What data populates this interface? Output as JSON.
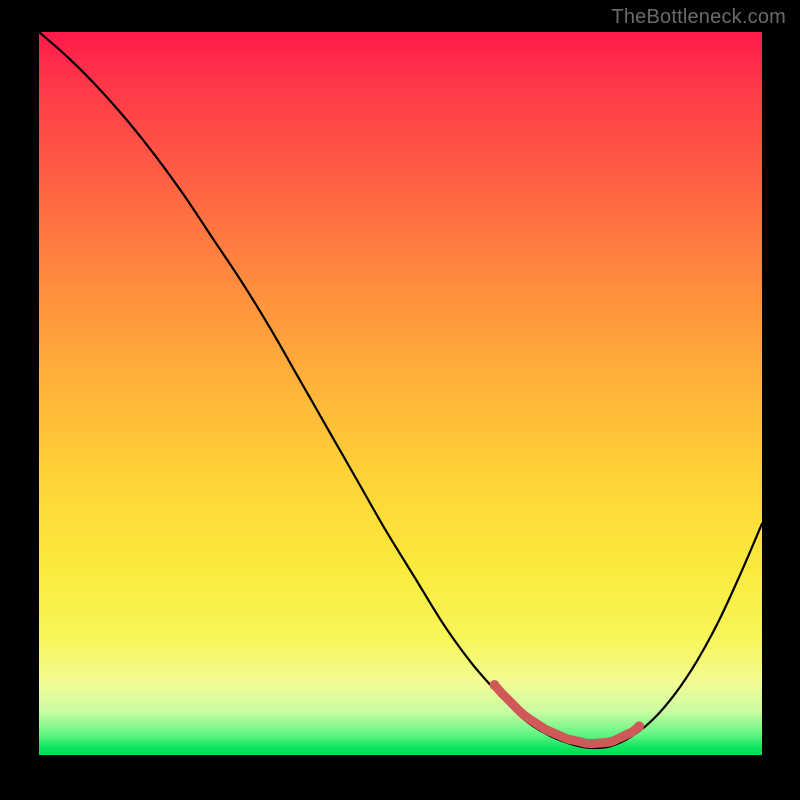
{
  "source": "TheBottleneck.com",
  "chart_data": {
    "type": "line",
    "title": "",
    "xlabel": "",
    "ylabel": "",
    "xlim": [
      0,
      100
    ],
    "ylim": [
      0,
      100
    ],
    "background": "vertical-heat-gradient",
    "gradient_stops": [
      {
        "pos": 0.0,
        "color": "#ff1a4b"
      },
      {
        "pos": 0.08,
        "color": "#ff3a49"
      },
      {
        "pos": 0.22,
        "color": "#ff6543"
      },
      {
        "pos": 0.35,
        "color": "#ff8d3e"
      },
      {
        "pos": 0.48,
        "color": "#ffb13a"
      },
      {
        "pos": 0.62,
        "color": "#ffd438"
      },
      {
        "pos": 0.74,
        "color": "#fbea3c"
      },
      {
        "pos": 0.84,
        "color": "#f7f65a"
      },
      {
        "pos": 0.9,
        "color": "#f3fc95"
      },
      {
        "pos": 0.94,
        "color": "#c9fca3"
      },
      {
        "pos": 0.972,
        "color": "#60f582"
      },
      {
        "pos": 0.99,
        "color": "#0be55e"
      },
      {
        "pos": 1.0,
        "color": "#07d959"
      }
    ],
    "series": [
      {
        "name": "bottleneck-curve",
        "x": [
          0,
          4,
          8,
          12,
          16,
          20,
          24,
          28,
          32,
          36,
          40,
          44,
          48,
          52,
          56,
          60,
          64,
          67,
          70,
          73,
          76,
          79,
          82,
          85,
          88,
          91,
          94,
          97,
          100
        ],
        "y": [
          100,
          96.5,
          92.5,
          88.0,
          83.0,
          77.5,
          71.5,
          65.5,
          59.0,
          52.0,
          45.0,
          38.0,
          31.0,
          24.5,
          18.0,
          12.5,
          8.0,
          5.0,
          3.0,
          1.7,
          1.0,
          1.2,
          2.6,
          5.0,
          8.5,
          13.0,
          18.5,
          25.0,
          32.0
        ]
      }
    ],
    "highlight": {
      "name": "optimal-range",
      "color": "#d15858",
      "x_start": 63,
      "x_end": 83,
      "endpoint_dots": true
    }
  }
}
